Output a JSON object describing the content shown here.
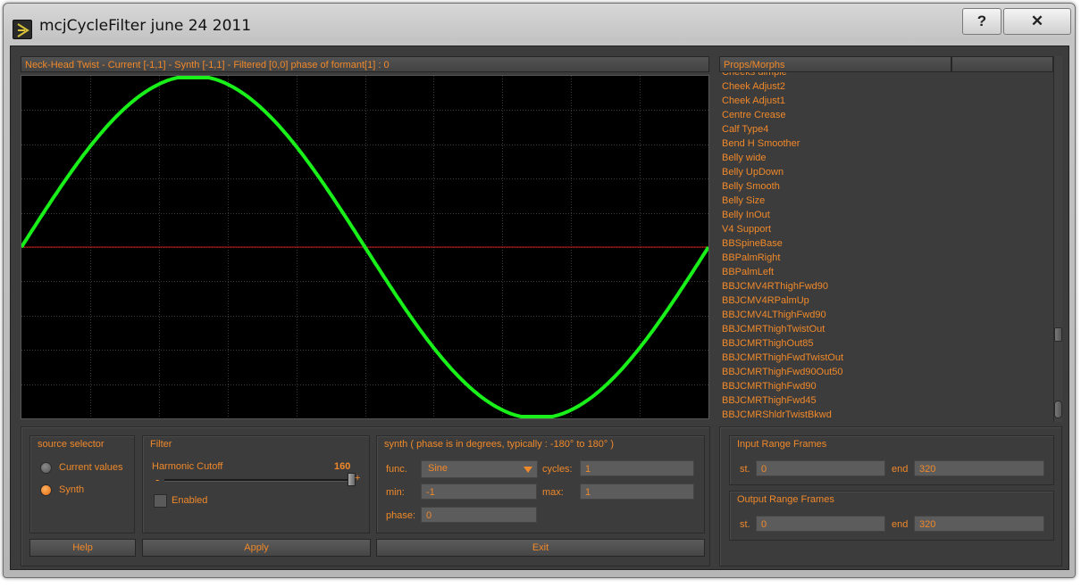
{
  "window": {
    "title": "mcjCycleFilter june 24 2011"
  },
  "caption_buttons": {
    "help": "?",
    "close": "✕"
  },
  "graph": {
    "header": "Neck-Head Twist  - Current [-1,1]     - Synth [-1,1]     - Filtered [0,0]     phase of formant[1] : 0",
    "colors": {
      "background": "#000000",
      "grid": "#3a3a3a",
      "synth": "#19f019",
      "baseline": "#cc1a1a"
    }
  },
  "chart_data": {
    "type": "line",
    "title": "",
    "xlabel": "",
    "ylabel": "",
    "xlim": [
      0,
      320
    ],
    "ylim": [
      -1,
      1
    ],
    "grid": true,
    "series": [
      {
        "function": "sine",
        "cycles": 1,
        "amplitude_min": -1,
        "amplitude_max": 1,
        "phase_deg": 0,
        "color": "#19f019"
      },
      {
        "function": "constant",
        "value": 0,
        "color": "#cc1a1a"
      }
    ]
  },
  "props": {
    "header": "Props/Morphs",
    "items": [
      "Cheeks dimple",
      "Cheek Adjust2",
      "Cheek Adjust1",
      "Centre Crease",
      "Calf Type4",
      "Bend H Smoother",
      "Belly wide",
      "Belly UpDown",
      "Belly Smooth",
      "Belly Size",
      "Belly InOut",
      "V4 Support",
      "BBSpineBase",
      "BBPalmRight",
      "BBPalmLeft",
      "BBJCMV4RThighFwd90",
      "BBJCMV4RPalmUp",
      "BBJCMV4LThighFwd90",
      "BBJCMRThighTwistOut",
      "BBJCMRThighOut85",
      "BBJCMRThighFwdTwistOut",
      "BBJCMRThighFwd90Out50",
      "BBJCMRThighFwd90",
      "BBJCMRThighFwd45",
      "BBJCMRShldrTwistBkwd"
    ],
    "scroll_fraction": 0.8
  },
  "source_selector": {
    "label": "source selector",
    "options": [
      "Current values",
      "Synth"
    ],
    "selected": "Synth"
  },
  "filter": {
    "label": "Filter",
    "cutoff_label": "Harmonic Cutoff",
    "cutoff_value": "160",
    "cutoff_fraction": 1.0,
    "minus": "-",
    "plus": "+",
    "enabled_label": "Enabled",
    "enabled": false
  },
  "synth": {
    "label": "synth ( phase is in degrees, typically : -180° to 180° )",
    "func_label": "func.",
    "func_value": "Sine",
    "cycles_label": "cycles:",
    "cycles_value": "1",
    "min_label": "min:",
    "min_value": "-1",
    "max_label": "max:",
    "max_value": "1",
    "phase_label": "phase:",
    "phase_value": "0"
  },
  "input_range": {
    "label": "Input Range Frames",
    "st_label": "st.",
    "st_value": "0",
    "end_label": "end",
    "end_value": "320"
  },
  "output_range": {
    "label": "Output Range Frames",
    "st_label": "st.",
    "st_value": "0",
    "end_label": "end",
    "end_value": "320"
  },
  "buttons": {
    "help": "Help",
    "apply": "Apply",
    "exit": "Exit"
  },
  "colors": {
    "accent": "#f0892a",
    "panel": "#3c3c3c",
    "field": "#5c5c5c"
  }
}
